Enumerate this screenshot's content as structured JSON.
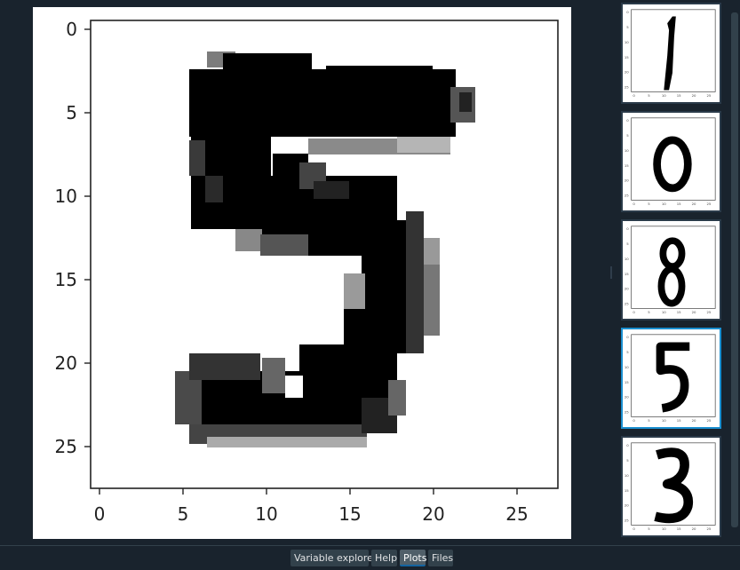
{
  "main_plot": {
    "x_ticks": [
      "0",
      "5",
      "10",
      "15",
      "20",
      "25"
    ],
    "y_ticks": [
      "0",
      "5",
      "10",
      "15",
      "20",
      "25"
    ],
    "digit": "5"
  },
  "thumbnails": [
    {
      "digit": "1",
      "selected": false
    },
    {
      "digit": "0",
      "selected": false
    },
    {
      "digit": "8",
      "selected": false
    },
    {
      "digit": "5",
      "selected": true
    },
    {
      "digit": "3",
      "selected": false
    }
  ],
  "thumb_ticks": [
    "0",
    "5",
    "10",
    "15",
    "20",
    "25"
  ],
  "tabs": [
    {
      "label": "Variable explorer",
      "active": false
    },
    {
      "label": "Help",
      "active": false
    },
    {
      "label": "Plots",
      "active": true
    },
    {
      "label": "Files",
      "active": false
    }
  ],
  "colors": {
    "background": "#19232d",
    "accent": "#1a8fd0",
    "tab_bg": "#32414b"
  }
}
